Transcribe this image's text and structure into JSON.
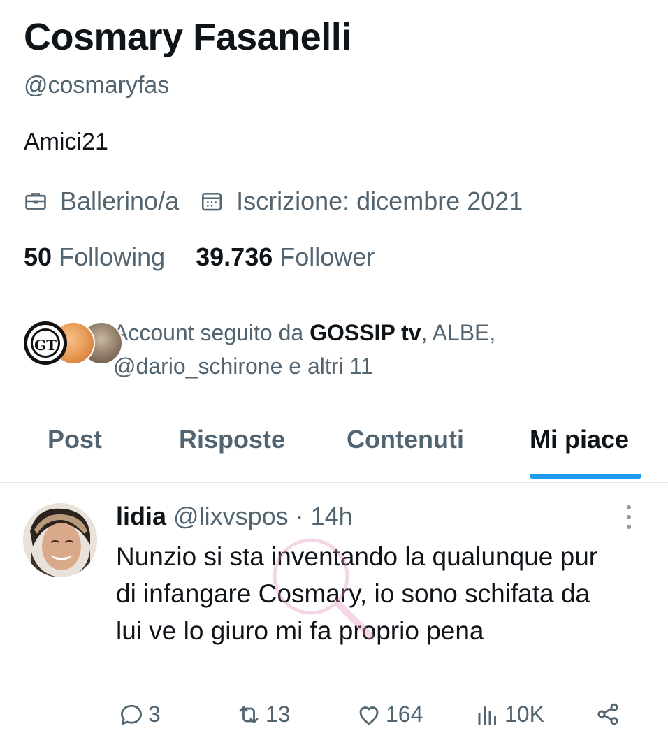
{
  "profile": {
    "display_name": "Cosmary Fasanelli",
    "handle": "@cosmaryfas",
    "bio": "Amici21",
    "profession": "Ballerino/a",
    "joined": "Iscrizione: dicembre 2021",
    "following_count": "50",
    "following_label": "Following",
    "followers_count": "39.736",
    "followers_label": "Follower",
    "followed_by_prefix": "Account seguito da",
    "followed_by_bold": "GOSSIP tv",
    "followed_by_rest1": ", ALBE,",
    "followed_by_rest2": "@dario_schirone e altri 11",
    "avatar_gt_text": "GT"
  },
  "tabs": [
    {
      "label": "Post",
      "active": false
    },
    {
      "label": "Risposte",
      "active": false
    },
    {
      "label": "Contenuti",
      "active": false
    },
    {
      "label": "Mi piace",
      "active": true
    }
  ],
  "tweet": {
    "author_name": "lidia",
    "author_handle_time": "@lixvspos · 14h",
    "text": "Nunzio si sta inventando la qualunque pur di infangare Cosmary, io sono schifata da lui ve lo giuro mi fa proprio pena",
    "replies": "3",
    "retweets": "13",
    "likes": "164",
    "views": "10K"
  },
  "colors": {
    "text_primary": "#0f1419",
    "text_secondary": "#536471",
    "accent": "#1d9bf0"
  },
  "icons": {
    "profession": "briefcase-icon",
    "joined": "calendar-icon",
    "reply": "reply-icon",
    "retweet": "retweet-icon",
    "like": "heart-icon",
    "views": "views-icon",
    "share": "share-icon",
    "more": "more-dots-icon"
  }
}
